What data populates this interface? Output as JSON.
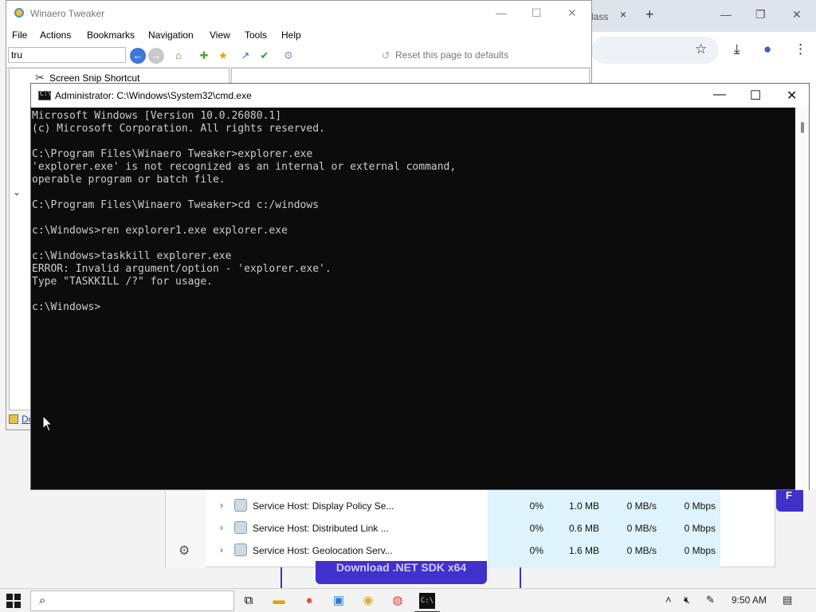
{
  "chrome": {
    "tab_label": "lass",
    "close_icon": "×",
    "newtab_icon": "+",
    "minimize": "—",
    "restore": "❐",
    "close": "✕",
    "star": "☆",
    "download": "⤓",
    "profile": "●",
    "menu": "⋮"
  },
  "blue_edge_text": "F",
  "taskmgr": {
    "rows": [
      {
        "name": "Service Host: Display Policy Se...",
        "cpu": "0%",
        "mem": "1.0 MB",
        "disk": "0 MB/s",
        "net": "0 Mbps"
      },
      {
        "name": "Service Host: Distributed Link ...",
        "cpu": "0%",
        "mem": "0.6 MB",
        "disk": "0 MB/s",
        "net": "0 Mbps"
      },
      {
        "name": "Service Host: Geolocation Serv...",
        "cpu": "0%",
        "mem": "1.6 MB",
        "disk": "0 MB/s",
        "net": "0 Mbps"
      }
    ]
  },
  "download_banner": "Download .NET SDK x64",
  "winaero": {
    "title": "Winaero Tweaker",
    "menu": [
      "File",
      "Actions",
      "Bookmarks",
      "Navigation",
      "View",
      "Tools",
      "Help"
    ],
    "search_value": "tru",
    "reset_label": "Reset this page to defaults",
    "tree_item": "Screen Snip Shortcut",
    "status_link": "Do"
  },
  "cmd": {
    "title": "Administrator: C:\\Windows\\System32\\cmd.exe",
    "lines": [
      "Microsoft Windows [Version 10.0.26080.1]",
      "(c) Microsoft Corporation. All rights reserved.",
      "",
      "C:\\Program Files\\Winaero Tweaker>explorer.exe",
      "'explorer.exe' is not recognized as an internal or external command,",
      "operable program or batch file.",
      "",
      "C:\\Program Files\\Winaero Tweaker>cd c:/windows",
      "",
      "c:\\Windows>ren explorer1.exe explorer.exe",
      "",
      "c:\\Windows>taskkill explorer.exe",
      "ERROR: Invalid argument/option - 'explorer.exe'.",
      "Type \"TASKKILL /?\" for usage.",
      "",
      "c:\\Windows>"
    ]
  },
  "taskbar": {
    "clock": "9:50 AM",
    "apps": [
      "task-view",
      "file-explorer",
      "firefox",
      "photos",
      "winaero",
      "chrome",
      "cmd"
    ]
  }
}
